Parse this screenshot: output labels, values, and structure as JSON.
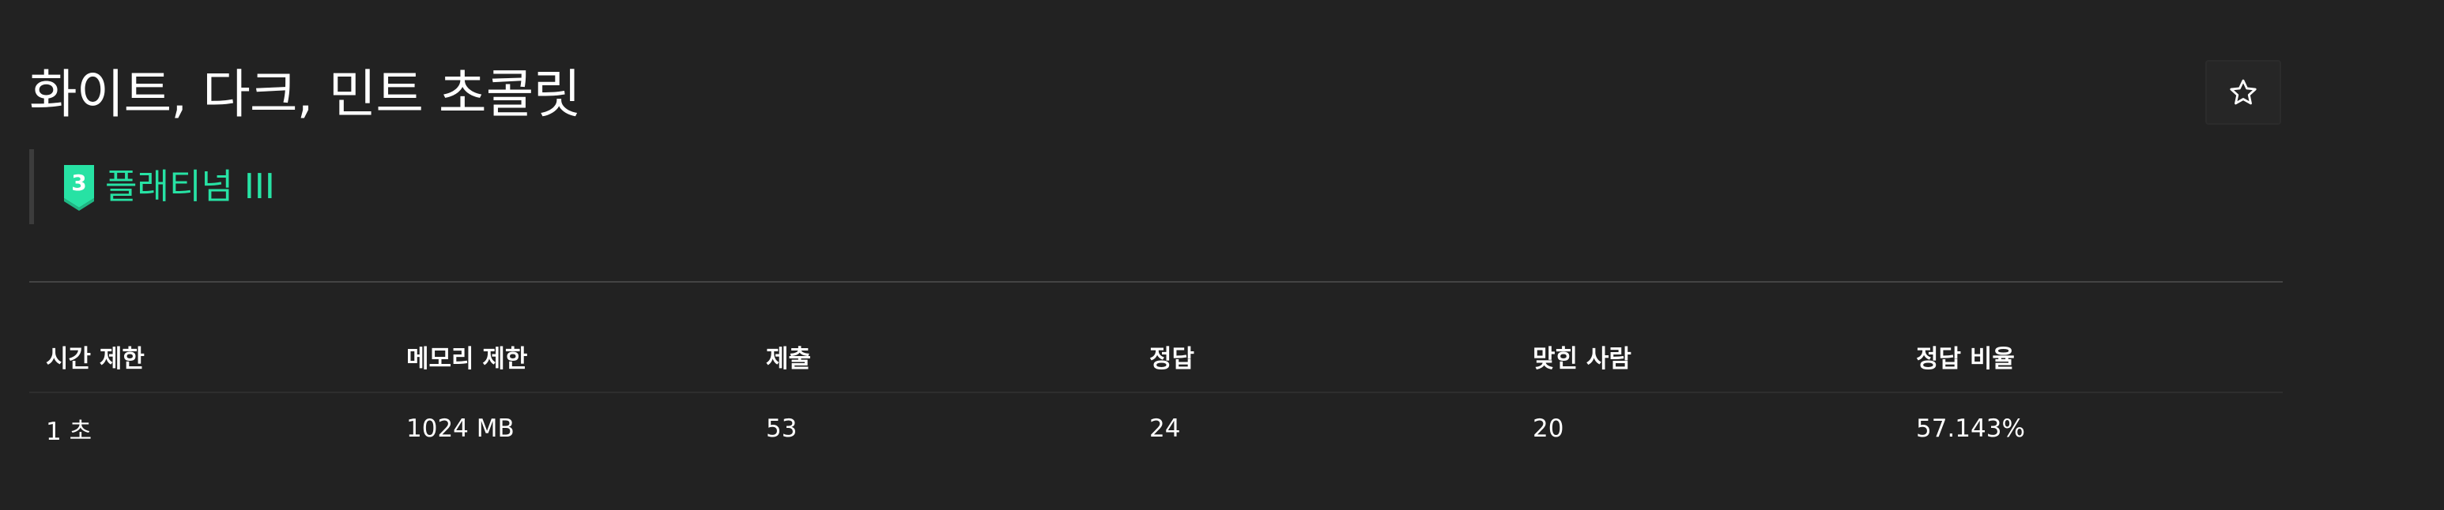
{
  "problem": {
    "title": "화이트, 다크, 민트 초콜릿",
    "tier": {
      "label": "플래티넘 III",
      "badge_number": "3",
      "color": "#27e2a4"
    },
    "star_icon": "star-outline-icon"
  },
  "info_table": {
    "headers": [
      "시간 제한",
      "메모리 제한",
      "제출",
      "정답",
      "맞힌 사람",
      "정답 비율"
    ],
    "values": [
      "1 초",
      "1024 MB",
      "53",
      "24",
      "20",
      "57.143%"
    ]
  }
}
